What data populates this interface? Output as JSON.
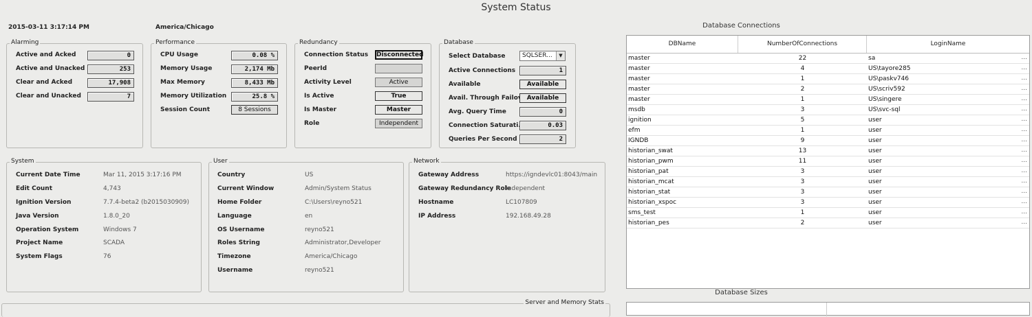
{
  "page": {
    "title": "System Status",
    "datetime": "2015-03-11 3:17:14 PM",
    "timezone": "America/Chicago"
  },
  "alarming": {
    "label": "Alarming",
    "rows": [
      {
        "label": "Active and Acked",
        "value": "0"
      },
      {
        "label": "Active and Unacked",
        "value": "253"
      },
      {
        "label": "Clear and Acked",
        "value": "17,908"
      },
      {
        "label": "Clear and Unacked",
        "value": "7"
      }
    ]
  },
  "performance": {
    "label": "Performance",
    "rows": [
      {
        "label": "CPU Usage",
        "value": "0.08 %"
      },
      {
        "label": "Memory Usage",
        "value": "2,174 Mb"
      },
      {
        "label": "Max Memory",
        "value": "8,433 Mb"
      },
      {
        "label": "Memory Utilization",
        "value": "25.8 %"
      },
      {
        "label": "Session Count",
        "value": "8 Sessions"
      }
    ]
  },
  "redundancy": {
    "label": "Redundancy",
    "rows": [
      {
        "label": "Connection Status",
        "value": "Disconnected"
      },
      {
        "label": "PeerId",
        "value": ""
      },
      {
        "label": "Activity Level",
        "value": "Active"
      },
      {
        "label": "Is Active",
        "value": "True"
      },
      {
        "label": "Is Master",
        "value": "Master"
      },
      {
        "label": "Role",
        "value": "Independent"
      }
    ]
  },
  "database": {
    "label": "Database",
    "select_label": "Select Database",
    "select_value": "SQLSER...",
    "rows": [
      {
        "label": "Active Connections",
        "value": "1"
      },
      {
        "label": "Available",
        "value": "Available"
      },
      {
        "label": "Avail. Through Failov...",
        "value": "Available"
      },
      {
        "label": "Avg. Query Time",
        "value": "0"
      },
      {
        "label": "Connection Saturati...",
        "value": "0.03"
      },
      {
        "label": "Queries Per Second",
        "value": "2"
      }
    ]
  },
  "system": {
    "label": "System",
    "rows": [
      {
        "label": "Current Date Time",
        "value": "Mar 11, 2015 3:17:16 PM"
      },
      {
        "label": "Edit Count",
        "value": "4,743"
      },
      {
        "label": "Ignition Version",
        "value": "7.7.4-beta2 (b2015030909)"
      },
      {
        "label": "Java Version",
        "value": "1.8.0_20"
      },
      {
        "label": "Operation System",
        "value": "Windows 7"
      },
      {
        "label": "Project Name",
        "value": "SCADA"
      },
      {
        "label": "System Flags",
        "value": "76"
      }
    ]
  },
  "user": {
    "label": "User",
    "rows": [
      {
        "label": "Country",
        "value": "US"
      },
      {
        "label": "Current Window",
        "value": "Admin/System Status"
      },
      {
        "label": "Home Folder",
        "value": "C:\\Users\\reyno521"
      },
      {
        "label": "Language",
        "value": "en"
      },
      {
        "label": "OS Username",
        "value": "reyno521"
      },
      {
        "label": "Roles String",
        "value": "Administrator,Developer"
      },
      {
        "label": "Timezone",
        "value": "America/Chicago"
      },
      {
        "label": "Username",
        "value": "reyno521"
      }
    ]
  },
  "network": {
    "label": "Network",
    "rows": [
      {
        "label": "Gateway Address",
        "value": "https://igndevlc01:8043/main"
      },
      {
        "label": "Gateway Redundancy Role",
        "value": "Independent"
      },
      {
        "label": "Hostname",
        "value": "LC107809"
      },
      {
        "label": "IP Address",
        "value": "192.168.49.28"
      }
    ]
  },
  "server_memory": {
    "label": "Server and Memory Stats"
  },
  "db_connections": {
    "title": "Database Connections",
    "columns": [
      "DBName",
      "NumberOfConnections",
      "LoginName"
    ],
    "rows": [
      [
        "master",
        "22",
        "sa"
      ],
      [
        "master",
        "4",
        "US\\tayore285"
      ],
      [
        "master",
        "1",
        "US\\paskv746"
      ],
      [
        "master",
        "2",
        "US\\scriv592"
      ],
      [
        "master",
        "1",
        "US\\singere"
      ],
      [
        "msdb",
        "3",
        "US\\svc-sql"
      ],
      [
        "ignition",
        "5",
        "user"
      ],
      [
        "efm",
        "1",
        "user"
      ],
      [
        "IGNDB",
        "9",
        "user"
      ],
      [
        "historian_swat",
        "13",
        "user"
      ],
      [
        "historian_pwm",
        "11",
        "user"
      ],
      [
        "historian_pat",
        "3",
        "user"
      ],
      [
        "historian_mcat",
        "3",
        "user"
      ],
      [
        "historian_stat",
        "3",
        "user"
      ],
      [
        "historian_xspoc",
        "3",
        "user"
      ],
      [
        "sms_test",
        "1",
        "user"
      ],
      [
        "historian_pes",
        "2",
        "user"
      ]
    ],
    "row_more": "..."
  },
  "db_sizes": {
    "title": "Database Sizes"
  }
}
